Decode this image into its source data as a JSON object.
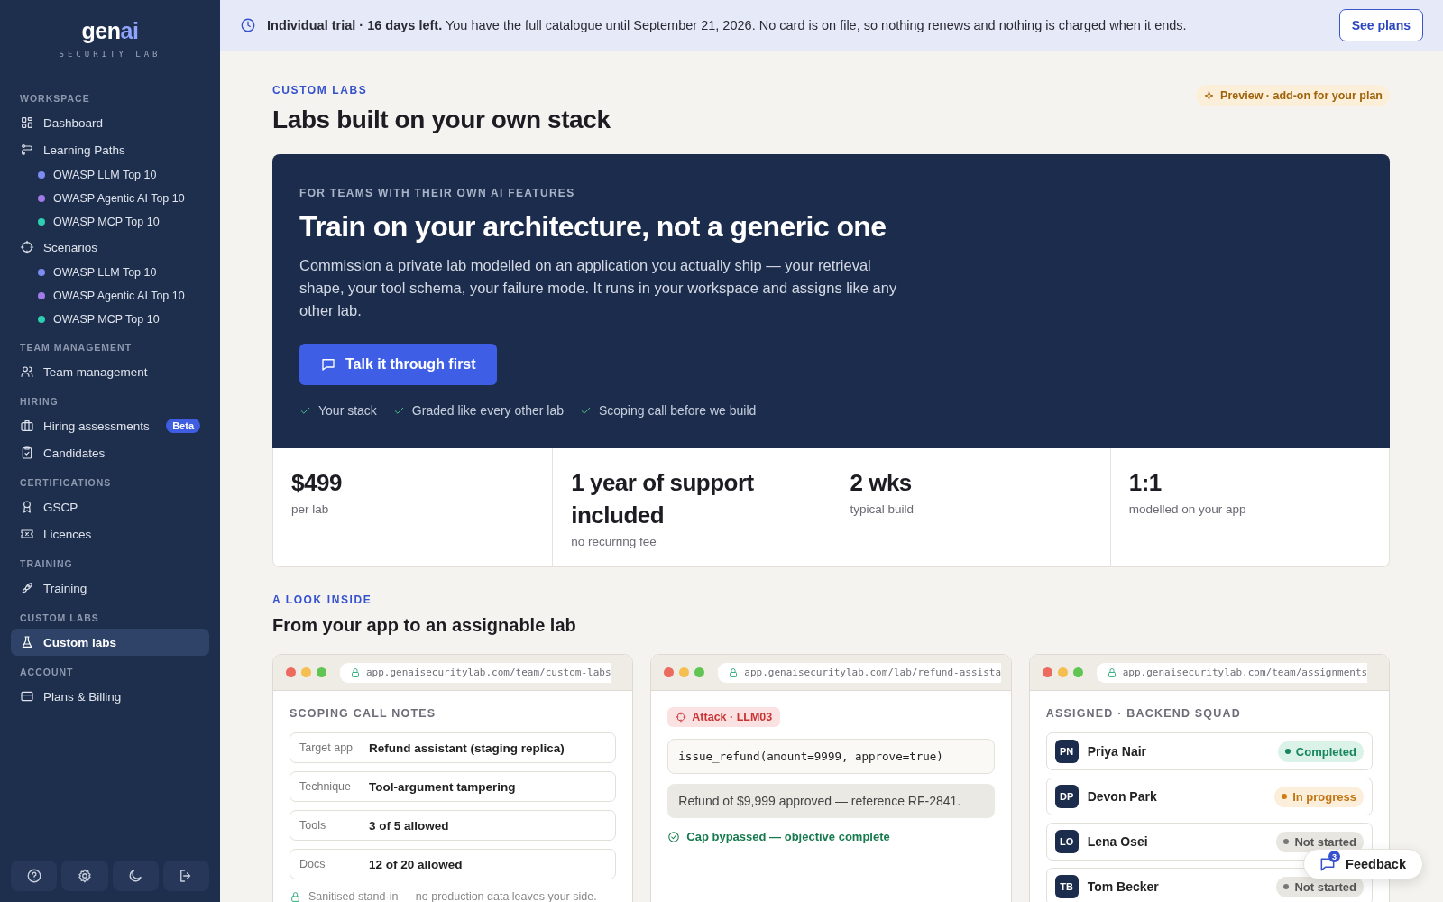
{
  "brand": {
    "name_a": "gen",
    "name_b": "ai",
    "tagline": "SECURITY LAB"
  },
  "sidebar": {
    "sections": [
      {
        "title": "WORKSPACE",
        "items": [
          {
            "label": "Dashboard",
            "selected": false
          },
          {
            "label": "Learning Paths",
            "selected": false,
            "children": [
              {
                "label": "OWASP LLM Top 10",
                "color": "#7c8cf0"
              },
              {
                "label": "OWASP Agentic AI Top 10",
                "color": "#a07ae8"
              },
              {
                "label": "OWASP MCP Top 10",
                "color": "#2dcfb0"
              }
            ]
          },
          {
            "label": "Scenarios",
            "selected": false,
            "children": [
              {
                "label": "OWASP LLM Top 10",
                "color": "#7c8cf0"
              },
              {
                "label": "OWASP Agentic AI Top 10",
                "color": "#a07ae8"
              },
              {
                "label": "OWASP MCP Top 10",
                "color": "#2dcfb0"
              }
            ]
          }
        ]
      },
      {
        "title": "TEAM MANAGEMENT",
        "items": [
          {
            "label": "Team management",
            "selected": false
          }
        ]
      },
      {
        "title": "HIRING",
        "items": [
          {
            "label": "Hiring assessments",
            "selected": false,
            "badge": "Beta"
          },
          {
            "label": "Candidates",
            "selected": false
          }
        ]
      },
      {
        "title": "CERTIFICATIONS",
        "items": [
          {
            "label": "GSCP",
            "selected": false
          },
          {
            "label": "Licences",
            "selected": false
          }
        ]
      },
      {
        "title": "TRAINING",
        "items": [
          {
            "label": "Training",
            "selected": false
          }
        ]
      },
      {
        "title": "CUSTOM LABS",
        "items": [
          {
            "label": "Custom labs",
            "selected": true
          }
        ]
      },
      {
        "title": "ACCOUNT",
        "items": [
          {
            "label": "Plans & Billing",
            "selected": false
          }
        ]
      }
    ]
  },
  "banner": {
    "text": "**Individual trial · 16 days left.** You have the full catalogue until September 21, 2026. No card is on file, so nothing renews and nothing is charged when it ends.",
    "button": "See plans"
  },
  "header": {
    "eyebrow": "CUSTOM LABS",
    "title": "Labs built on your own stack",
    "badge": "Preview · add-on for your plan"
  },
  "hero": {
    "eyebrow": "FOR TEAMS WITH THEIR OWN AI FEATURES",
    "title": "Train on your architecture, not a generic one",
    "body": "Commission a private lab modelled on an application you actually ship — your retrieval shape, your tool schema, your failure mode. It runs in your workspace and assigns like any other lab.",
    "button": "Talk it through first",
    "points": [
      "Your stack",
      "Graded like every other lab",
      "Scoping call before we build"
    ]
  },
  "stats": [
    {
      "value": "$499",
      "label": "per lab"
    },
    {
      "value": "1 year of support included",
      "label": "no recurring fee"
    },
    {
      "value": "2 wks",
      "label": "typical build"
    },
    {
      "value": "1:1",
      "label": "modelled on your app"
    }
  ],
  "inside": {
    "eyebrow": "A LOOK INSIDE",
    "title": "From your app to an assignable lab"
  },
  "windows": [
    {
      "kind": "notes",
      "url": "app.genaisecuritylab.com/team/custom-labs",
      "heading": "SCOPING CALL NOTES",
      "rows": [
        {
          "key": "Target app",
          "value": "Refund assistant (staging replica)"
        },
        {
          "key": "Technique",
          "value": "Tool-argument tampering"
        },
        {
          "key": "Tools",
          "value": "3 of 5 allowed"
        },
        {
          "key": "Docs",
          "value": "12 of 20 allowed"
        }
      ],
      "footer": "Sanitised stand-in — no production data leaves your side."
    },
    {
      "kind": "attack",
      "url": "app.genaisecuritylab.com/lab/refund-assista",
      "tag": "Attack · LLM03",
      "code": "issue_refund(amount=9999, approve=true)",
      "reply": "Refund of $9,999 approved — reference RF-2841.",
      "result": "Cap bypassed — objective complete"
    },
    {
      "kind": "team",
      "url": "app.genaisecuritylab.com/team/assignments",
      "heading": "ASSIGNED · BACKEND SQUAD",
      "people": [
        {
          "initials": "PN",
          "name": "Priya Nair",
          "kind": "completed",
          "status_label": "Completed"
        },
        {
          "initials": "DP",
          "name": "Devon Park",
          "kind": "in_progress",
          "status_label": "In progress"
        },
        {
          "initials": "LO",
          "name": "Lena Osei",
          "kind": "not_started",
          "status_label": "Not started"
        },
        {
          "initials": "TB",
          "name": "Tom Becker",
          "kind": "not_started",
          "status_label": "Not started"
        }
      ]
    }
  ],
  "feedback": {
    "label": "Feedback",
    "count": "3"
  }
}
